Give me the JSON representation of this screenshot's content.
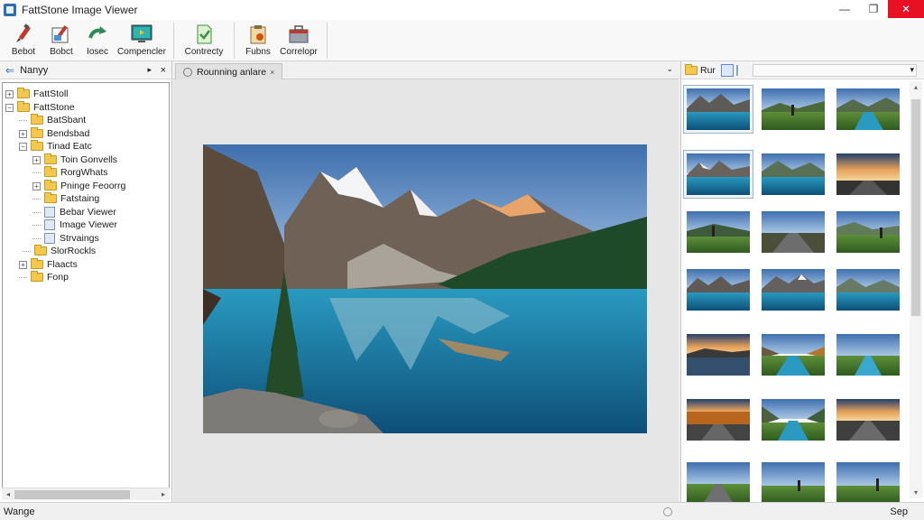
{
  "window": {
    "title": "FattStone Image Viewer",
    "controls": [
      "—",
      "❐",
      "✕"
    ]
  },
  "toolbar": {
    "buttons": [
      {
        "label": "Bebot",
        "icon": "edit-pen-icon"
      },
      {
        "label": "Bobсt",
        "icon": "edit-image-icon"
      },
      {
        "label": "Iosec",
        "icon": "rotate-arrow-icon"
      },
      {
        "label": "Compencler",
        "icon": "monitor-icon"
      },
      {
        "label": "Contrecty",
        "icon": "document-icon"
      },
      {
        "label": "Fubns",
        "icon": "clipboard-icon"
      },
      {
        "label": "Correlopr",
        "icon": "toolbox-icon"
      }
    ]
  },
  "left_panel": {
    "header": "Nanyy",
    "pin": "▸",
    "close": "×",
    "tree": [
      {
        "label": "FattStoll",
        "type": "folder",
        "expander": "+"
      },
      {
        "label": "FattStone",
        "type": "folder",
        "expander": "−"
      },
      {
        "label": "BatSbant",
        "type": "folder",
        "expander": ""
      },
      {
        "label": "Bendsbad",
        "type": "folder",
        "expander": "+"
      },
      {
        "label": "Tinad Eatc",
        "type": "folder",
        "expander": "−"
      },
      {
        "label": "Toin Gonvells",
        "type": "folder",
        "expander": "+"
      },
      {
        "label": "RorgWhats",
        "type": "folder",
        "expander": ""
      },
      {
        "label": "Pninge Feoorrg",
        "type": "folder",
        "expander": "+"
      },
      {
        "label": "Fatstaing",
        "type": "folder",
        "expander": ""
      },
      {
        "label": "Bebar Viewer",
        "type": "file",
        "expander": ""
      },
      {
        "label": "Image Viewer",
        "type": "file",
        "expander": ""
      },
      {
        "label": "Strvaings",
        "type": "file",
        "expander": ""
      },
      {
        "label": "SlorRockls",
        "type": "folder",
        "expander": ""
      },
      {
        "label": "Flaacts",
        "type": "folder",
        "expander": "+"
      },
      {
        "label": "Fonp",
        "type": "folder",
        "expander": ""
      }
    ]
  },
  "center": {
    "tab_label": "Rounning anlare",
    "tab_close": "×",
    "tab_menu": "⌄"
  },
  "right_panel": {
    "folder_label": "Rur",
    "dropdown_arrow": "▾"
  },
  "statusbar": {
    "left": "Wange",
    "right": "Sep"
  },
  "colors": {
    "titlebar": "#ffffff",
    "toolbar": "#f8f8f8",
    "close_button": "#e81123",
    "folder": "#f4c84e",
    "viewer_bg": "#e6e6e6",
    "lake": "#1f8ab0",
    "sky": "#5c8fc9"
  }
}
